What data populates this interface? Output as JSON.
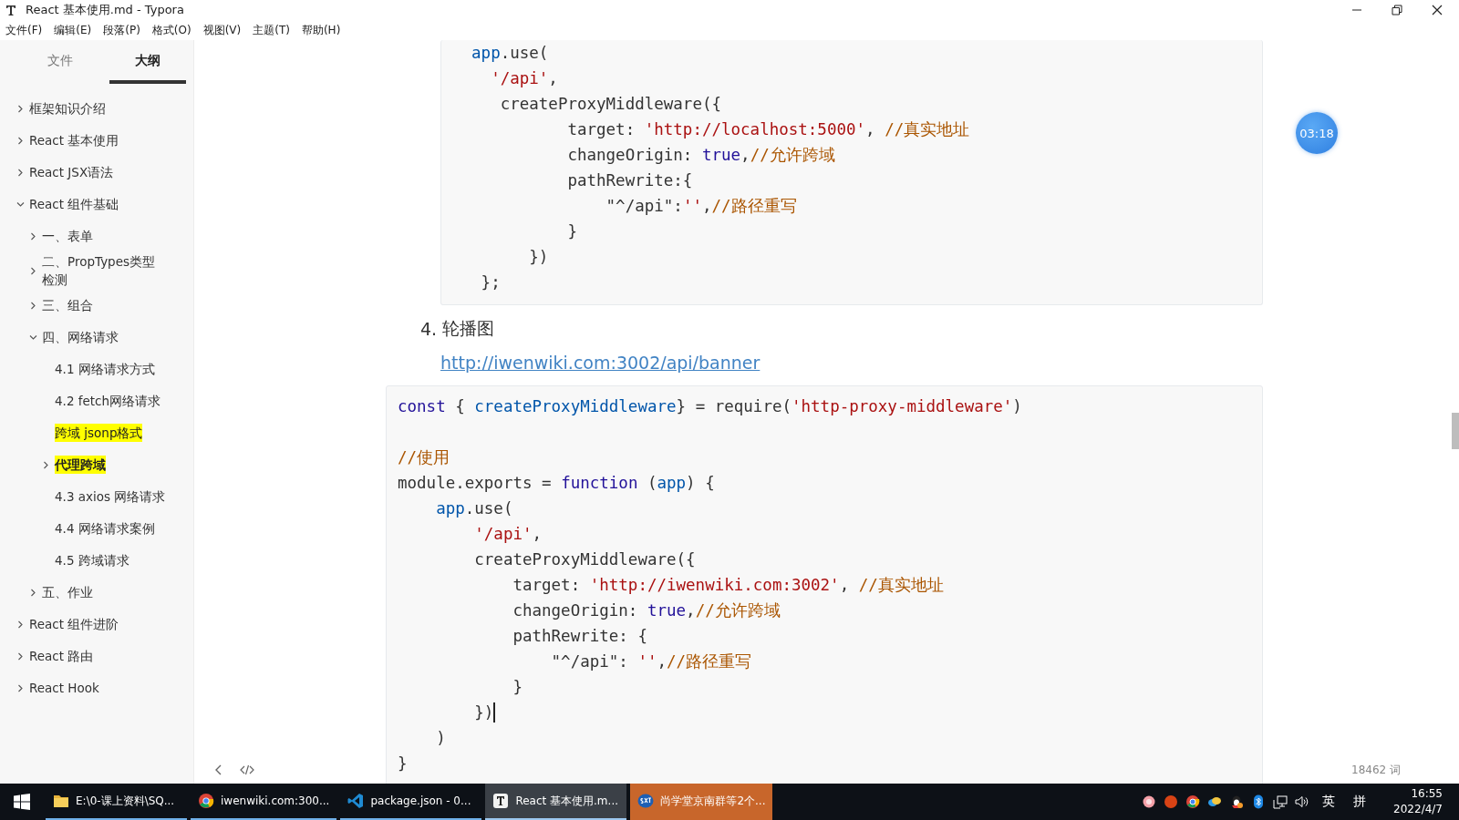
{
  "window": {
    "title": "React 基本使用.md - Typora"
  },
  "menu": [
    "文件(F)",
    "编辑(E)",
    "段落(P)",
    "格式(O)",
    "视图(V)",
    "主题(T)",
    "帮助(H)"
  ],
  "sidebar": {
    "tabs": [
      {
        "label": "文件",
        "selected": false
      },
      {
        "label": "大纲",
        "selected": true
      }
    ],
    "outline": [
      {
        "label": "框架知识介绍",
        "expanded": false
      },
      {
        "label": "React 基本使用",
        "expanded": false
      },
      {
        "label": "React JSX语法",
        "expanded": false
      },
      {
        "label": "React 组件基础",
        "expanded": true,
        "children": [
          {
            "label": "一、表单",
            "expanded": false
          },
          {
            "label": "二、PropTypes类型检测",
            "expanded": false
          },
          {
            "label": "三、组合",
            "expanded": false
          },
          {
            "label": "四、网络请求",
            "expanded": true,
            "children": [
              {
                "label": "4.1 网络请求方式"
              },
              {
                "label": "4.2 fetch网络请求"
              },
              {
                "label": "跨域 jsonp格式",
                "highlighted": true
              },
              {
                "label": "代理跨域",
                "expanded": false,
                "highlighted": true,
                "bold": true
              },
              {
                "label": "4.3 axios 网络请求"
              },
              {
                "label": "4.4 网络请求案例"
              },
              {
                "label": "4.5 跨域请求"
              }
            ]
          },
          {
            "label": "五、作业",
            "expanded": false
          }
        ]
      },
      {
        "label": "React 组件进阶",
        "expanded": false
      },
      {
        "label": "React 路由",
        "expanded": false
      },
      {
        "label": "React Hook",
        "expanded": false
      }
    ]
  },
  "document": {
    "blocks": [
      {
        "kind": "code",
        "lines": [
          {
            "tokens": [
              {
                "text": "  app",
                "kind": "var"
              },
              {
                "text": ".use("
              }
            ]
          },
          {
            "tokens": [
              {
                "text": "    '/api'",
                "kind": "str"
              },
              {
                "text": ","
              }
            ]
          },
          {
            "tokens": [
              {
                "text": "     createProxyMiddleware({"
              }
            ]
          },
          {
            "tokens": [
              {
                "text": "            target: "
              },
              {
                "text": "'http://localhost:5000'",
                "kind": "str"
              },
              {
                "text": ", "
              },
              {
                "text": "//真实地址",
                "kind": "comment"
              }
            ]
          },
          {
            "tokens": [
              {
                "text": "            changeOrigin: "
              },
              {
                "text": "true",
                "kind": "kw"
              },
              {
                "text": ","
              },
              {
                "text": "//允许跨域",
                "kind": "comment"
              }
            ]
          },
          {
            "tokens": [
              {
                "text": "            pathRewrite:{"
              }
            ]
          },
          {
            "tokens": [
              {
                "text": "                \"^/api\":"
              },
              {
                "text": "''",
                "kind": "str"
              },
              {
                "text": ","
              },
              {
                "text": "//路径重写",
                "kind": "comment"
              }
            ]
          },
          {
            "tokens": [
              {
                "text": "            }"
              }
            ]
          },
          {
            "tokens": [
              {
                "text": "        })"
              }
            ]
          },
          {
            "tokens": [
              {
                "text": "   };"
              }
            ]
          }
        ]
      },
      {
        "kind": "list_item",
        "number": "4.",
        "text": "轮播图"
      },
      {
        "kind": "link",
        "text": "http://iwenwiki.com:3002/api/banner"
      },
      {
        "kind": "code",
        "lines": [
          {
            "tokens": [
              {
                "text": "const",
                "kind": "kw"
              },
              {
                "text": " { "
              },
              {
                "text": "createProxyMiddleware",
                "kind": "def"
              },
              {
                "text": "} = require("
              },
              {
                "text": "'http-proxy-middleware'",
                "kind": "str"
              },
              {
                "text": ")"
              }
            ]
          },
          {
            "gap_before": true,
            "tokens": [
              {
                "text": "//使用",
                "kind": "comment"
              }
            ]
          },
          {
            "tokens": [
              {
                "text": "module.exports = "
              },
              {
                "text": "function",
                "kind": "kw"
              },
              {
                "text": " ("
              },
              {
                "text": "app",
                "kind": "def"
              },
              {
                "text": ") {"
              }
            ]
          },
          {
            "tokens": [
              {
                "text": "    app",
                "kind": "var"
              },
              {
                "text": ".use("
              }
            ]
          },
          {
            "tokens": [
              {
                "text": "        '/api'",
                "kind": "str"
              },
              {
                "text": ","
              }
            ]
          },
          {
            "tokens": [
              {
                "text": "        createProxyMiddleware({"
              }
            ]
          },
          {
            "tokens": [
              {
                "text": "            target: "
              },
              {
                "text": "'http://iwenwiki.com:3002'",
                "kind": "str"
              },
              {
                "text": ", "
              },
              {
                "text": "//真实地址",
                "kind": "comment"
              }
            ]
          },
          {
            "tokens": [
              {
                "text": "            changeOrigin: "
              },
              {
                "text": "true",
                "kind": "kw"
              },
              {
                "text": ","
              },
              {
                "text": "//允许跨域",
                "kind": "comment"
              }
            ]
          },
          {
            "tokens": [
              {
                "text": "            pathRewrite: {"
              }
            ]
          },
          {
            "tokens": [
              {
                "text": "                \"^/api\": "
              },
              {
                "text": "''",
                "kind": "str"
              },
              {
                "text": ","
              },
              {
                "text": "//路径重写",
                "kind": "comment"
              }
            ]
          },
          {
            "tokens": [
              {
                "text": "            }"
              }
            ]
          },
          {
            "caret": true,
            "tokens": [
              {
                "text": "        })"
              }
            ]
          },
          {
            "tokens": [
              {
                "text": "    )"
              }
            ]
          },
          {
            "tokens": [
              {
                "text": "}"
              }
            ]
          }
        ]
      }
    ]
  },
  "timer": "03:18",
  "word_count": "18462 词",
  "taskbar": {
    "tasks": [
      {
        "kind": "folder",
        "label": "E:\\0-课上资料\\SQ...",
        "active": false,
        "flashing": false
      },
      {
        "kind": "chrome",
        "label": "iwenwiki.com:300...",
        "active": false,
        "flashing": false
      },
      {
        "kind": "vscode",
        "label": "package.json - 0...",
        "active": false,
        "flashing": false
      },
      {
        "kind": "typora",
        "label": "React 基本使用.m...",
        "active": true,
        "flashing": false
      },
      {
        "kind": "sxt",
        "label": "尚学堂京南群等2个...",
        "active": false,
        "flashing": true
      }
    ],
    "ime_mode": "英",
    "ime_layout": "拼",
    "time": "16:55",
    "date": "2022/4/7"
  }
}
